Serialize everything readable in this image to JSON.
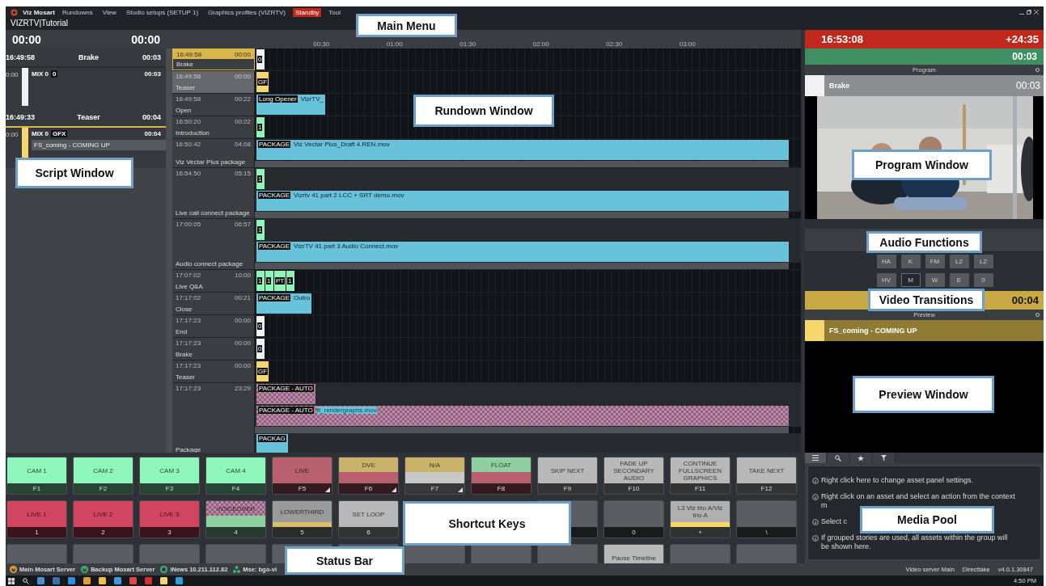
{
  "menu": {
    "app_name": "Viz Mosart",
    "items": [
      {
        "label": "Rundowns",
        "highlighted": false
      },
      {
        "label": "View",
        "highlighted": false
      },
      {
        "label": "Studio setups (SETUP 1)",
        "highlighted": false
      },
      {
        "label": "Graphics profiles (VIZRTV)",
        "highlighted": false
      },
      {
        "label": "Standby",
        "highlighted": true
      },
      {
        "label": "Tool",
        "highlighted": false
      }
    ]
  },
  "title": "VIZRTV|Tutorial",
  "timers": [
    "00:00",
    "00:00"
  ],
  "ruler": [
    "00:30",
    "01:00",
    "01:30",
    "02:00",
    "02:30",
    "03:00"
  ],
  "script": {
    "stories": [
      {
        "time": "16:49:58",
        "title": "Brake",
        "duration": "00:03",
        "selected": false,
        "items": [
          {
            "time": "0:00",
            "name": "MIX 0",
            "badge": "0",
            "duration": "00:03",
            "color": "#f2f2f2"
          }
        ]
      },
      {
        "time": "16:49:33",
        "title": "Teaser",
        "duration": "00:04",
        "selected": true,
        "items": [
          {
            "time": "0:00",
            "name": "MIX 0",
            "badge": "GFX",
            "duration": "00:04",
            "color": "#f5d76e",
            "caption": "FS_coming - COMING UP"
          }
        ]
      }
    ]
  },
  "rundown": [
    {
      "time": "16:49:58",
      "duration": "00:00",
      "title": "Brake",
      "selected": true,
      "highlighted": false,
      "tracks": [
        [
          {
            "kind": "tag",
            "label": "0",
            "color": "#f2f2f2"
          }
        ]
      ]
    },
    {
      "time": "16:49:58",
      "duration": "00:00",
      "title": "Teaser",
      "selected": false,
      "highlighted": true,
      "tracks": [
        [
          {
            "kind": "tag",
            "label": "GF",
            "color": "#f5d76e"
          }
        ]
      ]
    },
    {
      "time": "16:49:58",
      "duration": "00:22",
      "title": "Open",
      "selected": false,
      "highlighted": false,
      "tracks": [
        [
          {
            "kind": "short",
            "label": "Long Opener",
            "file": "VizrTV_"
          }
        ]
      ]
    },
    {
      "time": "16:50:20",
      "duration": "00:22",
      "title": "Introduction",
      "selected": false,
      "highlighted": false,
      "tracks": [
        [
          {
            "kind": "tag",
            "label": "1",
            "color": "#8ef5bb"
          }
        ]
      ]
    },
    {
      "time": "16:50:42",
      "duration": "04:08",
      "title": "Viz Vectar Plus package",
      "selected": false,
      "highlighted": false,
      "tracks": [
        [
          {
            "kind": "package",
            "label": "PACKAGE",
            "file": "Viz Vectar Plus_Draft 4.REN.mov"
          }
        ]
      ]
    },
    {
      "time": "16:54:50",
      "duration": "05:15",
      "title": "Live call connect package",
      "selected": false,
      "highlighted": false,
      "tracks": [
        [
          {
            "kind": "tag",
            "label": "1",
            "color": "#8ef5bb"
          }
        ],
        [
          {
            "kind": "package",
            "label": "PACKAGE",
            "file": "Vizrtv 41 part 2 LCC + SRT demo.mov"
          }
        ]
      ]
    },
    {
      "time": "17:00:05",
      "duration": "06:57",
      "title": "Audio connect package",
      "selected": false,
      "highlighted": false,
      "tracks": [
        [
          {
            "kind": "tag",
            "label": "1",
            "color": "#8ef5bb"
          }
        ],
        [
          {
            "kind": "package",
            "label": "PACKAGE",
            "file": "VizrTV 41 part 3 Audio Connect.mov"
          }
        ]
      ]
    },
    {
      "time": "17:07:02",
      "duration": "10:00",
      "title": "Live Q&A",
      "selected": false,
      "highlighted": false,
      "tracks": [
        [
          {
            "kind": "tag",
            "label": "1",
            "color": "#8ef5bb"
          },
          {
            "kind": "tag",
            "label": "1",
            "color": "#8ef5bb"
          },
          {
            "kind": "tag",
            "label": "PT",
            "color": "#8ef5bb"
          },
          {
            "kind": "tag",
            "label": "1",
            "color": "#8ef5bb"
          }
        ]
      ]
    },
    {
      "time": "17:17:02",
      "duration": "00:21",
      "title": "Close",
      "selected": false,
      "highlighted": false,
      "tracks": [
        [
          {
            "kind": "short",
            "label": "PACKAGE",
            "file": "Outro"
          }
        ]
      ]
    },
    {
      "time": "17:17:23",
      "duration": "00:00",
      "title": "End",
      "selected": false,
      "highlighted": false,
      "tracks": [
        [
          {
            "kind": "tag",
            "label": "0",
            "color": "#f2f2f2"
          }
        ]
      ]
    },
    {
      "time": "17:17:23",
      "duration": "00:00",
      "title": "Brake",
      "selected": false,
      "highlighted": false,
      "tracks": [
        [
          {
            "kind": "tag",
            "label": "0",
            "color": "#f2f2f2"
          }
        ]
      ]
    },
    {
      "time": "17:17:23",
      "duration": "00:00",
      "title": "Teaser",
      "selected": false,
      "highlighted": false,
      "tracks": [
        [
          {
            "kind": "tag",
            "label": "GF",
            "color": "#f5d76e"
          }
        ]
      ]
    },
    {
      "time": "17:17:23",
      "duration": "23:29",
      "title": "Package",
      "selected": false,
      "highlighted": false,
      "tracks": [
        [
          {
            "kind": "checker",
            "label": "PACKAGE - AUTO"
          }
        ],
        [
          {
            "kind": "checkerbar",
            "label": "PACKAGE - AUTO",
            "file": "tt_rendergraphs.mov"
          }
        ],
        [
          {
            "kind": "short",
            "label": "PACKAG"
          }
        ]
      ]
    }
  ],
  "program": {
    "clock": "16:53:08",
    "over": "+24:35",
    "remaining": "00:03",
    "header": "Program",
    "item": {
      "title": "Brake",
      "duration": "00:03",
      "color": "#f2f2f2"
    }
  },
  "audio": {
    "buttons": [
      [
        {
          "label": "HA",
          "selected": false
        },
        {
          "label": "K",
          "selected": false
        },
        {
          "label": "FM",
          "selected": false
        },
        {
          "label": "L2",
          "selected": false
        },
        {
          "label": "L2",
          "selected": false
        }
      ],
      [
        {
          "label": "HV",
          "selected": false
        },
        {
          "label": "M",
          "selected": true
        },
        {
          "label": "W",
          "selected": false
        },
        {
          "label": "E",
          "selected": false
        },
        {
          "label": "0",
          "selected": false
        }
      ]
    ]
  },
  "preview": {
    "remaining": "00:04",
    "header": "Preview",
    "item": {
      "title": "FS_coming - COMING UP",
      "color": "#f5d76e"
    }
  },
  "shortcut_keys": [
    [
      {
        "label": "CAM 1",
        "key": "F1",
        "kind": "plain",
        "bands": [
          {
            "color": "#8ef5bb"
          }
        ],
        "corner": false
      },
      {
        "label": "CAM 2",
        "key": "F2",
        "kind": "plain",
        "bands": [
          {
            "color": "#8ef5bb"
          }
        ],
        "corner": false
      },
      {
        "label": "CAM 3",
        "key": "F3",
        "kind": "plain",
        "bands": [
          {
            "color": "#8ef5bb"
          }
        ],
        "corner": false
      },
      {
        "label": "CAM 4",
        "key": "F4",
        "kind": "plain",
        "bands": [
          {
            "color": "#8ef5bb"
          }
        ],
        "corner": false
      },
      {
        "label": "LIVE",
        "key": "F5",
        "kind": "plain",
        "bands": [
          {
            "color": "#b9606f"
          }
        ],
        "corner": true
      },
      {
        "label": "DVE",
        "key": "F6",
        "kind": "split",
        "bands": [
          {
            "color": "#c9b36a"
          },
          {
            "color": "#b9606f"
          }
        ],
        "corner": true
      },
      {
        "label": "N/A",
        "key": "F7",
        "kind": "split",
        "bands": [
          {
            "color": "#c9b36a"
          },
          {
            "color": "#c8c8c8"
          }
        ],
        "corner": true
      },
      {
        "label": "FLOAT",
        "key": "F8",
        "kind": "split",
        "bands": [
          {
            "color": "#8fd0a0"
          },
          {
            "color": "#b9606f"
          }
        ],
        "corner": false
      },
      {
        "label": "SKIP NEXT",
        "key": "F9",
        "kind": "plain",
        "bands": [
          {
            "color": "#b8b8b8"
          }
        ],
        "corner": false
      },
      {
        "label": "FADE UP SECONDARY AUDIO",
        "key": "F10",
        "kind": "plain",
        "bands": [
          {
            "color": "#b8b8b8"
          }
        ],
        "corner": false
      },
      {
        "label": "CONTINUE FULLSCREEN GRAPHICS",
        "key": "F11",
        "kind": "plain",
        "bands": [
          {
            "color": "#b8b8b8"
          }
        ],
        "corner": false
      },
      {
        "label": "TAKE NEXT",
        "key": "F12",
        "kind": "plain",
        "bands": [
          {
            "color": "#b8b8b8"
          }
        ],
        "corner": false
      }
    ],
    [
      {
        "label": "LIVE 1",
        "key": "1",
        "kind": "plain",
        "bands": [
          {
            "color": "#d24560"
          }
        ],
        "corner": false
      },
      {
        "label": "LIVE 2",
        "key": "2",
        "kind": "plain",
        "bands": [
          {
            "color": "#d24560"
          }
        ],
        "corner": false
      },
      {
        "label": "LIVE 3",
        "key": "3",
        "kind": "plain",
        "bands": [
          {
            "color": "#d24560"
          }
        ],
        "corner": false
      },
      {
        "label": "VOICEOVER",
        "key": "4",
        "kind": "checker",
        "bands": [
          {
            "color": "#8fd0a0"
          }
        ],
        "corner": false
      },
      {
        "label": "LOWERTHIRD",
        "key": "5",
        "kind": "stripe",
        "bands": [
          {
            "color": "#9a9a9a"
          },
          {
            "color": "#d8c06a"
          }
        ],
        "corner": false
      },
      {
        "label": "SET LOOP",
        "key": "6",
        "kind": "plain",
        "bands": [
          {
            "color": "#b8b8b8"
          }
        ],
        "corner": false
      },
      {
        "kind": "covered"
      },
      {
        "kind": "covered"
      },
      {
        "kind": "plain",
        "bands": [
          {
            "color": "#5a5d61"
          }
        ],
        "corner": false
      },
      {
        "key": "0",
        "kind": "plain",
        "bands": [
          {
            "color": "#5a5d61"
          }
        ],
        "corner": false
      },
      {
        "label": "L3 Viz trio A/Viz trio A",
        "key": "+",
        "kind": "stripe",
        "bands": [
          {
            "color": "#b0b0b0"
          },
          {
            "color": "#f5d76e"
          }
        ],
        "corner": false
      },
      {
        "key": "\\",
        "kind": "plain",
        "bands": [
          {
            "color": "#5a5d61"
          }
        ],
        "corner": false
      }
    ],
    [
      {
        "kind": "plain",
        "bands": [
          {
            "color": "#5a5d61"
          }
        ]
      },
      {
        "kind": "plain",
        "bands": [
          {
            "color": "#5a5d61"
          }
        ]
      },
      {
        "kind": "plain",
        "bands": [
          {
            "color": "#5a5d61"
          }
        ]
      },
      {
        "kind": "plain",
        "bands": [
          {
            "color": "#5a5d61"
          }
        ]
      },
      {
        "kind": "plain",
        "bands": [
          {
            "color": "#5a5d61"
          }
        ]
      },
      {
        "kind": "plain",
        "bands": [
          {
            "color": "#5a5d61"
          }
        ]
      },
      {
        "kind": "plain",
        "bands": [
          {
            "color": "#5a5d61"
          }
        ]
      },
      {
        "kind": "plain",
        "bands": [
          {
            "color": "#5a5d61"
          }
        ]
      },
      {
        "kind": "plain",
        "bands": [
          {
            "color": "#5a5d61"
          }
        ]
      },
      {
        "label": "Pause Timeline",
        "kind": "plain",
        "bands": [
          {
            "color": "#b8b8b8"
          }
        ]
      },
      {
        "kind": "plain",
        "bands": [
          {
            "color": "#5a5d61"
          }
        ]
      },
      {
        "kind": "plain",
        "bands": [
          {
            "color": "#5a5d61"
          }
        ]
      }
    ]
  ],
  "media_pool": {
    "tabs": [
      {
        "kind": "list",
        "selected": true
      },
      {
        "kind": "search",
        "selected": false
      },
      {
        "kind": "star",
        "selected": false
      },
      {
        "kind": "filter",
        "selected": false
      }
    ],
    "hints": [
      "Right click here to change asset panel settings.",
      "Right click on an asset and select an action from the context m",
      "Select c",
      "If grouped stories are used, all assets within the group will be shown here."
    ]
  },
  "status_bar": {
    "servers": [
      {
        "label": "Main Mosart Server",
        "kind": "power",
        "color": "#e8a030"
      },
      {
        "label": "Backup Mosart Server",
        "kind": "power",
        "color": "#3cb371"
      },
      {
        "label": "iNews 10.211.112.82",
        "kind": "ring",
        "color": "#3cb371"
      },
      {
        "label": "Mse: bgo-vi",
        "kind": "network",
        "color": "#3cb371"
      }
    ],
    "right": [
      "Video server Main",
      "Directtake",
      "v4.0.1.30847"
    ]
  },
  "taskbar": {
    "time": "4:50 PM"
  },
  "callouts": [
    "Main Menu",
    "Rundown Window",
    "Script Window",
    "Program Window",
    "Audio Functions",
    "Video Transitions",
    "Preview Window",
    "Shortcut Keys",
    "Status Bar",
    "Media Pool"
  ]
}
